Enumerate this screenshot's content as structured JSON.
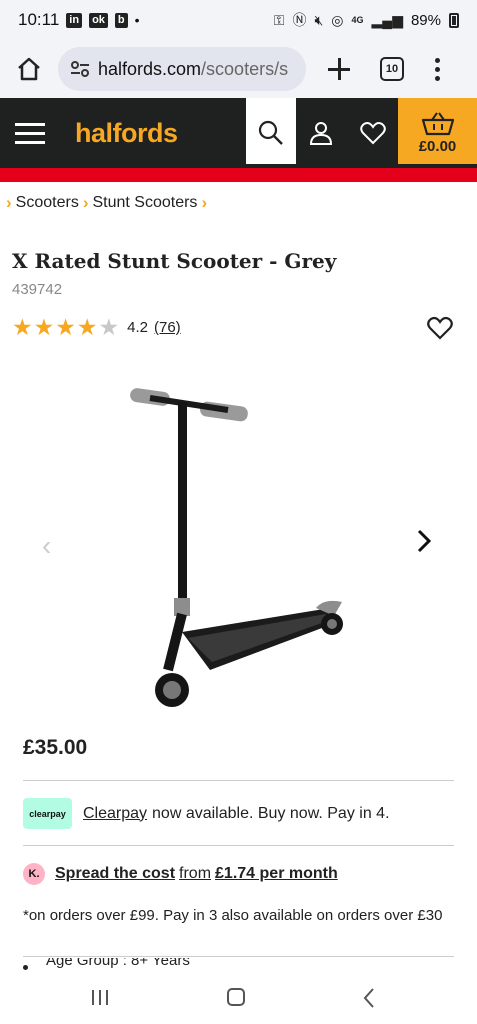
{
  "status_bar": {
    "time": "10:11",
    "app_icons": [
      "in",
      "ok",
      "b"
    ],
    "battery": "89%",
    "network": "4G"
  },
  "browser": {
    "url_host": "halfords.com",
    "url_path": "/scooters/s",
    "tab_count": "10"
  },
  "site_header": {
    "logo": "halfords",
    "basket_total": "£0.00",
    "brand_color": "#f7a823"
  },
  "breadcrumb": [
    "Scooters",
    "Stunt Scooters"
  ],
  "product": {
    "title": "X Rated Stunt Scooter - Grey",
    "sku": "439742",
    "rating_value": "4.2",
    "rating_count": "(76)",
    "stars_filled": 4,
    "stars_total": 5,
    "price": "£35.00"
  },
  "clearpay": {
    "badge": "clearpay",
    "link": "Clearpay",
    "text": "now available. Buy now. Pay in 4."
  },
  "klarna": {
    "badge": "K.",
    "link": "Spread the cost",
    "from": "from",
    "amount": "£1.74 per month"
  },
  "terms": "*on orders over £99. Pay in 3 also available on orders over £30",
  "spec_partial": "Age Group : 8+ Years"
}
